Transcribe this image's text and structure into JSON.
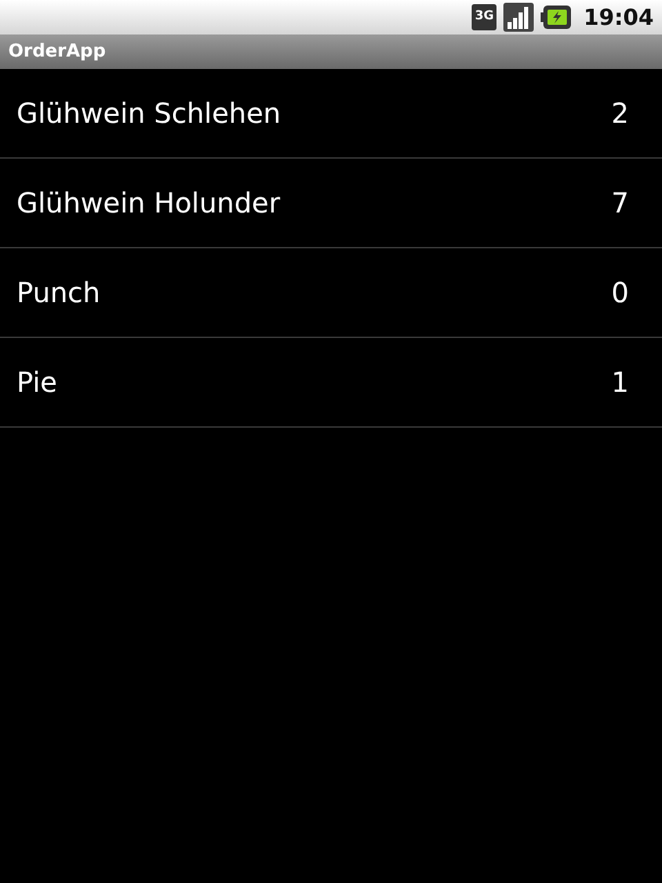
{
  "status_bar": {
    "network": "3G",
    "time": "19:04"
  },
  "window": {
    "title": "OrderApp"
  },
  "items": [
    {
      "name": "Glühwein Schlehen",
      "count": "2"
    },
    {
      "name": "Glühwein Holunder",
      "count": "7"
    },
    {
      "name": "Punch",
      "count": "0"
    },
    {
      "name": "Pie",
      "count": "1"
    }
  ]
}
